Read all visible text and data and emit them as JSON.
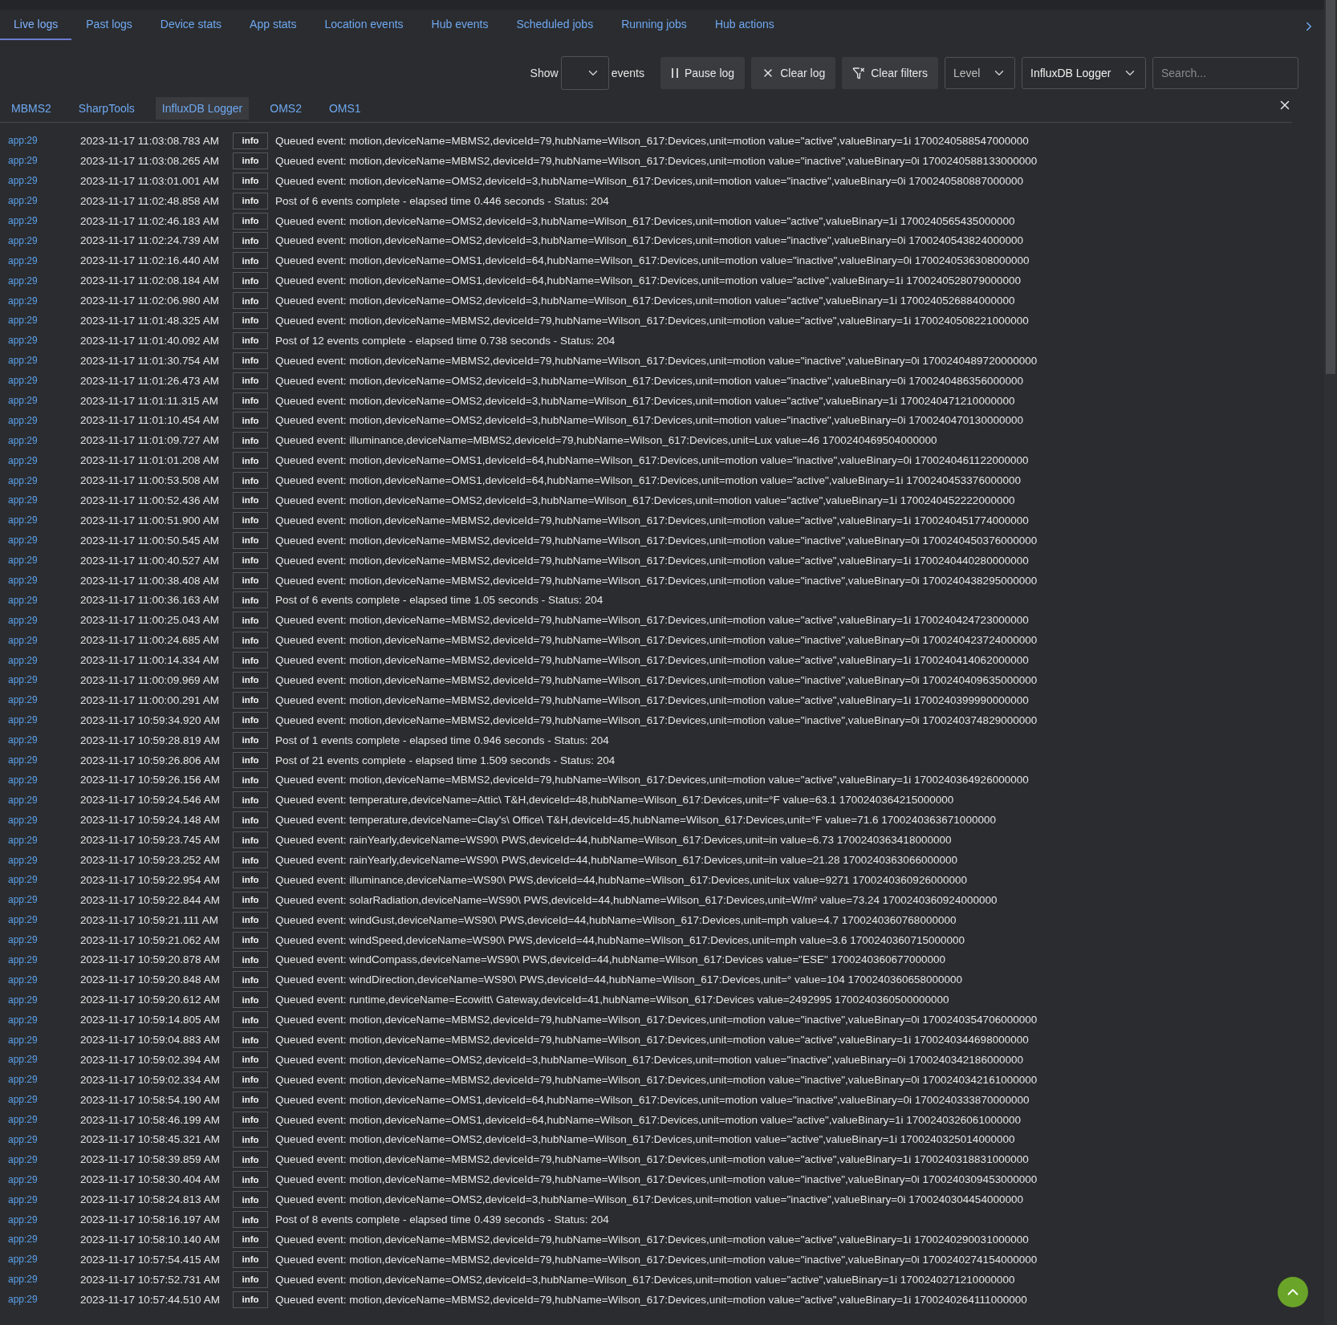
{
  "main_tabs": [
    {
      "label": "Live logs",
      "selected": true
    },
    {
      "label": "Past logs",
      "selected": false
    },
    {
      "label": "Device stats",
      "selected": false
    },
    {
      "label": "App stats",
      "selected": false
    },
    {
      "label": "Location events",
      "selected": false
    },
    {
      "label": "Hub events",
      "selected": false
    },
    {
      "label": "Scheduled jobs",
      "selected": false
    },
    {
      "label": "Running jobs",
      "selected": false
    },
    {
      "label": "Hub actions",
      "selected": false
    }
  ],
  "toolbar": {
    "show_label": "Show",
    "events_label": "events",
    "pause_button": "Pause log",
    "clear_button": "Clear log",
    "clear_filters_button": "Clear filters",
    "level_select": "Level",
    "source_select": "InfluxDB Logger",
    "search": {
      "placeholder": "Search..."
    }
  },
  "source_tabs": [
    {
      "label": "MBMS2",
      "selected": false
    },
    {
      "label": "SharpTools",
      "selected": false
    },
    {
      "label": "InfluxDB Logger",
      "selected": true
    },
    {
      "label": "OMS2",
      "selected": false
    },
    {
      "label": "OMS1",
      "selected": false
    }
  ],
  "log_rows": [
    {
      "source": "app:29",
      "time": "2023-11-17 11:03:08.783 AM",
      "level": "info",
      "message": "Queued event: motion,deviceName=MBMS2,deviceId=79,hubName=Wilson_617:Devices,unit=motion value=\"active\",valueBinary=1i 1700240588547000000"
    },
    {
      "source": "app:29",
      "time": "2023-11-17 11:03:08.265 AM",
      "level": "info",
      "message": "Queued event: motion,deviceName=MBMS2,deviceId=79,hubName=Wilson_617:Devices,unit=motion value=\"inactive\",valueBinary=0i 1700240588133000000"
    },
    {
      "source": "app:29",
      "time": "2023-11-17 11:03:01.001 AM",
      "level": "info",
      "message": "Queued event: motion,deviceName=OMS2,deviceId=3,hubName=Wilson_617:Devices,unit=motion value=\"inactive\",valueBinary=0i 1700240580887000000"
    },
    {
      "source": "app:29",
      "time": "2023-11-17 11:02:48.858 AM",
      "level": "info",
      "message": "Post of 6 events complete - elapsed time 0.446 seconds - Status: 204"
    },
    {
      "source": "app:29",
      "time": "2023-11-17 11:02:46.183 AM",
      "level": "info",
      "message": "Queued event: motion,deviceName=OMS2,deviceId=3,hubName=Wilson_617:Devices,unit=motion value=\"active\",valueBinary=1i 1700240565435000000"
    },
    {
      "source": "app:29",
      "time": "2023-11-17 11:02:24.739 AM",
      "level": "info",
      "message": "Queued event: motion,deviceName=OMS2,deviceId=3,hubName=Wilson_617:Devices,unit=motion value=\"inactive\",valueBinary=0i 1700240543824000000"
    },
    {
      "source": "app:29",
      "time": "2023-11-17 11:02:16.440 AM",
      "level": "info",
      "message": "Queued event: motion,deviceName=OMS1,deviceId=64,hubName=Wilson_617:Devices,unit=motion value=\"inactive\",valueBinary=0i 1700240536308000000"
    },
    {
      "source": "app:29",
      "time": "2023-11-17 11:02:08.184 AM",
      "level": "info",
      "message": "Queued event: motion,deviceName=OMS1,deviceId=64,hubName=Wilson_617:Devices,unit=motion value=\"active\",valueBinary=1i 1700240528079000000"
    },
    {
      "source": "app:29",
      "time": "2023-11-17 11:02:06.980 AM",
      "level": "info",
      "message": "Queued event: motion,deviceName=OMS2,deviceId=3,hubName=Wilson_617:Devices,unit=motion value=\"active\",valueBinary=1i 1700240526884000000"
    },
    {
      "source": "app:29",
      "time": "2023-11-17 11:01:48.325 AM",
      "level": "info",
      "message": "Queued event: motion,deviceName=MBMS2,deviceId=79,hubName=Wilson_617:Devices,unit=motion value=\"active\",valueBinary=1i 1700240508221000000"
    },
    {
      "source": "app:29",
      "time": "2023-11-17 11:01:40.092 AM",
      "level": "info",
      "message": "Post of 12 events complete - elapsed time 0.738 seconds - Status: 204"
    },
    {
      "source": "app:29",
      "time": "2023-11-17 11:01:30.754 AM",
      "level": "info",
      "message": "Queued event: motion,deviceName=MBMS2,deviceId=79,hubName=Wilson_617:Devices,unit=motion value=\"inactive\",valueBinary=0i 1700240489720000000"
    },
    {
      "source": "app:29",
      "time": "2023-11-17 11:01:26.473 AM",
      "level": "info",
      "message": "Queued event: motion,deviceName=OMS2,deviceId=3,hubName=Wilson_617:Devices,unit=motion value=\"inactive\",valueBinary=0i 1700240486356000000"
    },
    {
      "source": "app:29",
      "time": "2023-11-17 11:01:11.315 AM",
      "level": "info",
      "message": "Queued event: motion,deviceName=OMS2,deviceId=3,hubName=Wilson_617:Devices,unit=motion value=\"active\",valueBinary=1i 1700240471210000000"
    },
    {
      "source": "app:29",
      "time": "2023-11-17 11:01:10.454 AM",
      "level": "info",
      "message": "Queued event: motion,deviceName=OMS2,deviceId=3,hubName=Wilson_617:Devices,unit=motion value=\"inactive\",valueBinary=0i 1700240470130000000"
    },
    {
      "source": "app:29",
      "time": "2023-11-17 11:01:09.727 AM",
      "level": "info",
      "message": "Queued event: illuminance,deviceName=MBMS2,deviceId=79,hubName=Wilson_617:Devices,unit=Lux value=46 1700240469504000000"
    },
    {
      "source": "app:29",
      "time": "2023-11-17 11:01:01.208 AM",
      "level": "info",
      "message": "Queued event: motion,deviceName=OMS1,deviceId=64,hubName=Wilson_617:Devices,unit=motion value=\"inactive\",valueBinary=0i 1700240461122000000"
    },
    {
      "source": "app:29",
      "time": "2023-11-17 11:00:53.508 AM",
      "level": "info",
      "message": "Queued event: motion,deviceName=OMS1,deviceId=64,hubName=Wilson_617:Devices,unit=motion value=\"active\",valueBinary=1i 1700240453376000000"
    },
    {
      "source": "app:29",
      "time": "2023-11-17 11:00:52.436 AM",
      "level": "info",
      "message": "Queued event: motion,deviceName=OMS2,deviceId=3,hubName=Wilson_617:Devices,unit=motion value=\"active\",valueBinary=1i 1700240452222000000"
    },
    {
      "source": "app:29",
      "time": "2023-11-17 11:00:51.900 AM",
      "level": "info",
      "message": "Queued event: motion,deviceName=MBMS2,deviceId=79,hubName=Wilson_617:Devices,unit=motion value=\"active\",valueBinary=1i 1700240451774000000"
    },
    {
      "source": "app:29",
      "time": "2023-11-17 11:00:50.545 AM",
      "level": "info",
      "message": "Queued event: motion,deviceName=MBMS2,deviceId=79,hubName=Wilson_617:Devices,unit=motion value=\"inactive\",valueBinary=0i 1700240450376000000"
    },
    {
      "source": "app:29",
      "time": "2023-11-17 11:00:40.527 AM",
      "level": "info",
      "message": "Queued event: motion,deviceName=MBMS2,deviceId=79,hubName=Wilson_617:Devices,unit=motion value=\"active\",valueBinary=1i 1700240440280000000"
    },
    {
      "source": "app:29",
      "time": "2023-11-17 11:00:38.408 AM",
      "level": "info",
      "message": "Queued event: motion,deviceName=MBMS2,deviceId=79,hubName=Wilson_617:Devices,unit=motion value=\"inactive\",valueBinary=0i 1700240438295000000"
    },
    {
      "source": "app:29",
      "time": "2023-11-17 11:00:36.163 AM",
      "level": "info",
      "message": "Post of 6 events complete - elapsed time 1.05 seconds - Status: 204"
    },
    {
      "source": "app:29",
      "time": "2023-11-17 11:00:25.043 AM",
      "level": "info",
      "message": "Queued event: motion,deviceName=MBMS2,deviceId=79,hubName=Wilson_617:Devices,unit=motion value=\"active\",valueBinary=1i 1700240424723000000"
    },
    {
      "source": "app:29",
      "time": "2023-11-17 11:00:24.685 AM",
      "level": "info",
      "message": "Queued event: motion,deviceName=MBMS2,deviceId=79,hubName=Wilson_617:Devices,unit=motion value=\"inactive\",valueBinary=0i 1700240423724000000"
    },
    {
      "source": "app:29",
      "time": "2023-11-17 11:00:14.334 AM",
      "level": "info",
      "message": "Queued event: motion,deviceName=MBMS2,deviceId=79,hubName=Wilson_617:Devices,unit=motion value=\"active\",valueBinary=1i 1700240414062000000"
    },
    {
      "source": "app:29",
      "time": "2023-11-17 11:00:09.969 AM",
      "level": "info",
      "message": "Queued event: motion,deviceName=MBMS2,deviceId=79,hubName=Wilson_617:Devices,unit=motion value=\"inactive\",valueBinary=0i 1700240409635000000"
    },
    {
      "source": "app:29",
      "time": "2023-11-17 11:00:00.291 AM",
      "level": "info",
      "message": "Queued event: motion,deviceName=MBMS2,deviceId=79,hubName=Wilson_617:Devices,unit=motion value=\"active\",valueBinary=1i 1700240399990000000"
    },
    {
      "source": "app:29",
      "time": "2023-11-17 10:59:34.920 AM",
      "level": "info",
      "message": "Queued event: motion,deviceName=MBMS2,deviceId=79,hubName=Wilson_617:Devices,unit=motion value=\"inactive\",valueBinary=0i 1700240374829000000"
    },
    {
      "source": "app:29",
      "time": "2023-11-17 10:59:28.819 AM",
      "level": "info",
      "message": "Post of 1 events complete - elapsed time 0.946 seconds - Status: 204"
    },
    {
      "source": "app:29",
      "time": "2023-11-17 10:59:26.806 AM",
      "level": "info",
      "message": "Post of 21 events complete - elapsed time 1.509 seconds - Status: 204"
    },
    {
      "source": "app:29",
      "time": "2023-11-17 10:59:26.156 AM",
      "level": "info",
      "message": "Queued event: motion,deviceName=MBMS2,deviceId=79,hubName=Wilson_617:Devices,unit=motion value=\"active\",valueBinary=1i 1700240364926000000"
    },
    {
      "source": "app:29",
      "time": "2023-11-17 10:59:24.546 AM",
      "level": "info",
      "message": "Queued event: temperature,deviceName=Attic\\ T&H,deviceId=48,hubName=Wilson_617:Devices,unit=°F value=63.1 1700240364215000000"
    },
    {
      "source": "app:29",
      "time": "2023-11-17 10:59:24.148 AM",
      "level": "info",
      "message": "Queued event: temperature,deviceName=Clay's\\ Office\\ T&H,deviceId=45,hubName=Wilson_617:Devices,unit=°F value=71.6 1700240363671000000"
    },
    {
      "source": "app:29",
      "time": "2023-11-17 10:59:23.745 AM",
      "level": "info",
      "message": "Queued event: rainYearly,deviceName=WS90\\ PWS,deviceId=44,hubName=Wilson_617:Devices,unit=in value=6.73 1700240363418000000"
    },
    {
      "source": "app:29",
      "time": "2023-11-17 10:59:23.252 AM",
      "level": "info",
      "message": "Queued event: rainYearly,deviceName=WS90\\ PWS,deviceId=44,hubName=Wilson_617:Devices,unit=in value=21.28 1700240363066000000"
    },
    {
      "source": "app:29",
      "time": "2023-11-17 10:59:22.954 AM",
      "level": "info",
      "message": "Queued event: illuminance,deviceName=WS90\\ PWS,deviceId=44,hubName=Wilson_617:Devices,unit=lux value=9271 1700240360926000000"
    },
    {
      "source": "app:29",
      "time": "2023-11-17 10:59:22.844 AM",
      "level": "info",
      "message": "Queued event: solarRadiation,deviceName=WS90\\ PWS,deviceId=44,hubName=Wilson_617:Devices,unit=W/m² value=73.24 1700240360924000000"
    },
    {
      "source": "app:29",
      "time": "2023-11-17 10:59:21.111 AM",
      "level": "info",
      "message": "Queued event: windGust,deviceName=WS90\\ PWS,deviceId=44,hubName=Wilson_617:Devices,unit=mph value=4.7 1700240360768000000"
    },
    {
      "source": "app:29",
      "time": "2023-11-17 10:59:21.062 AM",
      "level": "info",
      "message": "Queued event: windSpeed,deviceName=WS90\\ PWS,deviceId=44,hubName=Wilson_617:Devices,unit=mph value=3.6 1700240360715000000"
    },
    {
      "source": "app:29",
      "time": "2023-11-17 10:59:20.878 AM",
      "level": "info",
      "message": "Queued event: windCompass,deviceName=WS90\\ PWS,deviceId=44,hubName=Wilson_617:Devices value=\"ESE\" 1700240360677000000"
    },
    {
      "source": "app:29",
      "time": "2023-11-17 10:59:20.848 AM",
      "level": "info",
      "message": "Queued event: windDirection,deviceName=WS90\\ PWS,deviceId=44,hubName=Wilson_617:Devices,unit=° value=104 1700240360658000000"
    },
    {
      "source": "app:29",
      "time": "2023-11-17 10:59:20.612 AM",
      "level": "info",
      "message": "Queued event: runtime,deviceName=Ecowitt\\ Gateway,deviceId=41,hubName=Wilson_617:Devices value=2492995 1700240360500000000"
    },
    {
      "source": "app:29",
      "time": "2023-11-17 10:59:14.805 AM",
      "level": "info",
      "message": "Queued event: motion,deviceName=MBMS2,deviceId=79,hubName=Wilson_617:Devices,unit=motion value=\"inactive\",valueBinary=0i 1700240354706000000"
    },
    {
      "source": "app:29",
      "time": "2023-11-17 10:59:04.883 AM",
      "level": "info",
      "message": "Queued event: motion,deviceName=MBMS2,deviceId=79,hubName=Wilson_617:Devices,unit=motion value=\"active\",valueBinary=1i 1700240344698000000"
    },
    {
      "source": "app:29",
      "time": "2023-11-17 10:59:02.394 AM",
      "level": "info",
      "message": "Queued event: motion,deviceName=OMS2,deviceId=3,hubName=Wilson_617:Devices,unit=motion value=\"inactive\",valueBinary=0i 1700240342186000000"
    },
    {
      "source": "app:29",
      "time": "2023-11-17 10:59:02.334 AM",
      "level": "info",
      "message": "Queued event: motion,deviceName=MBMS2,deviceId=79,hubName=Wilson_617:Devices,unit=motion value=\"inactive\",valueBinary=0i 1700240342161000000"
    },
    {
      "source": "app:29",
      "time": "2023-11-17 10:58:54.190 AM",
      "level": "info",
      "message": "Queued event: motion,deviceName=OMS1,deviceId=64,hubName=Wilson_617:Devices,unit=motion value=\"inactive\",valueBinary=0i 1700240333870000000"
    },
    {
      "source": "app:29",
      "time": "2023-11-17 10:58:46.199 AM",
      "level": "info",
      "message": "Queued event: motion,deviceName=OMS1,deviceId=64,hubName=Wilson_617:Devices,unit=motion value=\"active\",valueBinary=1i 1700240326061000000"
    },
    {
      "source": "app:29",
      "time": "2023-11-17 10:58:45.321 AM",
      "level": "info",
      "message": "Queued event: motion,deviceName=OMS2,deviceId=3,hubName=Wilson_617:Devices,unit=motion value=\"active\",valueBinary=1i 1700240325014000000"
    },
    {
      "source": "app:29",
      "time": "2023-11-17 10:58:39.859 AM",
      "level": "info",
      "message": "Queued event: motion,deviceName=MBMS2,deviceId=79,hubName=Wilson_617:Devices,unit=motion value=\"active\",valueBinary=1i 1700240318831000000"
    },
    {
      "source": "app:29",
      "time": "2023-11-17 10:58:30.404 AM",
      "level": "info",
      "message": "Queued event: motion,deviceName=MBMS2,deviceId=79,hubName=Wilson_617:Devices,unit=motion value=\"inactive\",valueBinary=0i 1700240309453000000"
    },
    {
      "source": "app:29",
      "time": "2023-11-17 10:58:24.813 AM",
      "level": "info",
      "message": "Queued event: motion,deviceName=OMS2,deviceId=3,hubName=Wilson_617:Devices,unit=motion value=\"inactive\",valueBinary=0i 1700240304454000000"
    },
    {
      "source": "app:29",
      "time": "2023-11-17 10:58:16.197 AM",
      "level": "info",
      "message": "Post of 8 events complete - elapsed time 0.439 seconds - Status: 204"
    },
    {
      "source": "app:29",
      "time": "2023-11-17 10:58:10.140 AM",
      "level": "info",
      "message": "Queued event: motion,deviceName=MBMS2,deviceId=79,hubName=Wilson_617:Devices,unit=motion value=\"active\",valueBinary=1i 1700240290031000000"
    },
    {
      "source": "app:29",
      "time": "2023-11-17 10:57:54.415 AM",
      "level": "info",
      "message": "Queued event: motion,deviceName=MBMS2,deviceId=79,hubName=Wilson_617:Devices,unit=motion value=\"inactive\",valueBinary=0i 1700240274154000000"
    },
    {
      "source": "app:29",
      "time": "2023-11-17 10:57:52.731 AM",
      "level": "info",
      "message": "Queued event: motion,deviceName=OMS2,deviceId=3,hubName=Wilson_617:Devices,unit=motion value=\"active\",valueBinary=1i 1700240271210000000"
    },
    {
      "source": "app:29",
      "time": "2023-11-17 10:57:44.510 AM",
      "level": "info",
      "message": "Queued event: motion,deviceName=MBMS2,deviceId=79,hubName=Wilson_617:Devices,unit=motion value=\"active\",valueBinary=1i 1700240264111000000"
    }
  ]
}
